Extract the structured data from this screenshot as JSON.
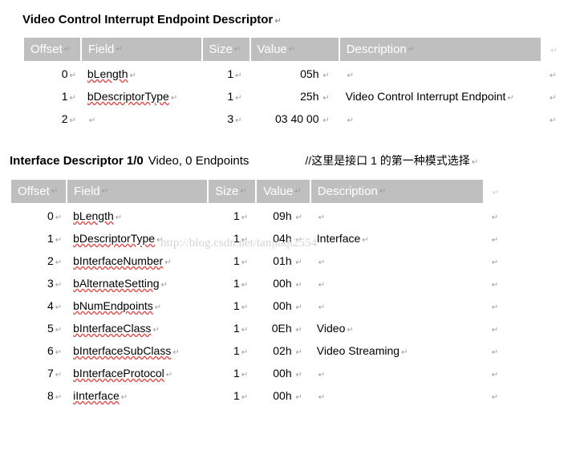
{
  "watermark": "http://blog.csdn.net/tanjiaqi2554",
  "section1": {
    "title": "Video Control Interrupt Endpoint Descriptor",
    "headers": [
      "Offset",
      "Field",
      "Size",
      "Value",
      "Description"
    ],
    "rows": [
      {
        "offset": "0",
        "field": "bLength",
        "size": "1",
        "value": "05h",
        "description": ""
      },
      {
        "offset": "1",
        "field": "bDescriptorType",
        "size": "1",
        "value": "25h",
        "description": "Video Control Interrupt Endpoint"
      },
      {
        "offset": "2",
        "field": "",
        "size": "3",
        "value": "03 40 00",
        "description": ""
      }
    ]
  },
  "section2": {
    "title_bold": "Interface Descriptor 1/0",
    "title_sub": "Video, 0 Endpoints",
    "comment": "//这里是接口 1 的第一种模式选择",
    "headers": [
      "Offset",
      "Field",
      "Size",
      "Value",
      "Description"
    ],
    "rows": [
      {
        "offset": "0",
        "field": "bLength",
        "size": "1",
        "value": "09h",
        "description": ""
      },
      {
        "offset": "1",
        "field": "bDescriptorType",
        "size": "1",
        "value": "04h",
        "description": "Interface"
      },
      {
        "offset": "2",
        "field": "bInterfaceNumber",
        "size": "1",
        "value": "01h",
        "description": ""
      },
      {
        "offset": "3",
        "field": "bAlternateSetting",
        "size": "1",
        "value": "00h",
        "description": ""
      },
      {
        "offset": "4",
        "field": "bNumEndpoints",
        "size": "1",
        "value": "00h",
        "description": ""
      },
      {
        "offset": "5",
        "field": "bInterfaceClass",
        "size": "1",
        "value": "0Eh",
        "description": "Video"
      },
      {
        "offset": "6",
        "field": "bInterfaceSubClass",
        "size": "1",
        "value": "02h",
        "description": "Video Streaming"
      },
      {
        "offset": "7",
        "field": "bInterfaceProtocol",
        "size": "1",
        "value": "00h",
        "description": ""
      },
      {
        "offset": "8",
        "field": "iInterface",
        "size": "1",
        "value": "00h",
        "description": ""
      }
    ]
  }
}
